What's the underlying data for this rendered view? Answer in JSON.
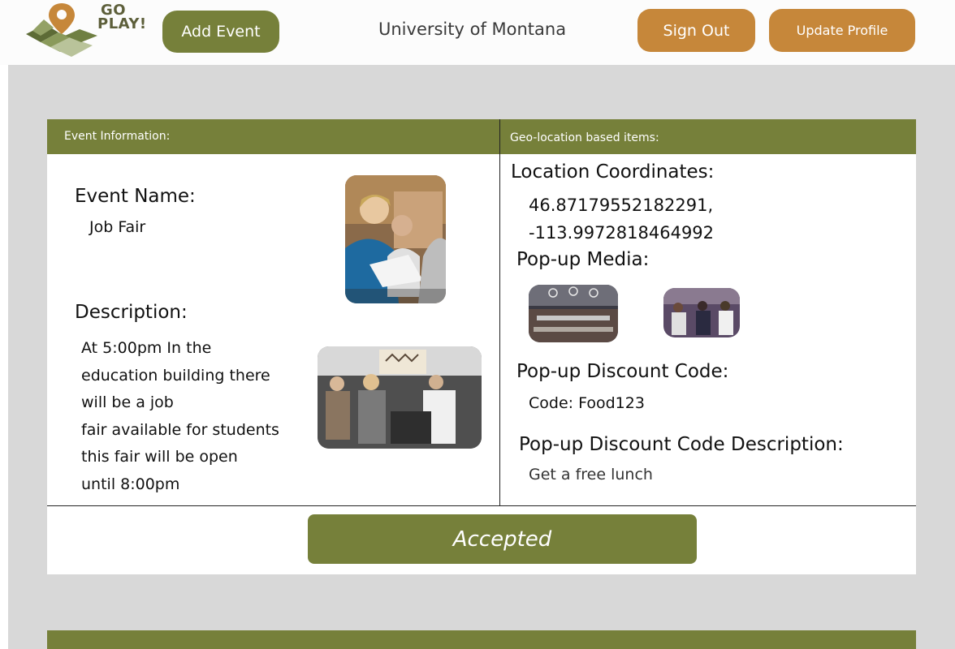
{
  "header": {
    "logo": {
      "line1": "GO",
      "line2": "PLAY!"
    },
    "add_event_label": "Add Event",
    "title": "University of Montana",
    "sign_out_label": "Sign Out",
    "update_profile_label": "Update Profile"
  },
  "event_card": {
    "event_info_header": "Event Information:",
    "geo_header": "Geo-location based items:",
    "event_name_label": "Event Name:",
    "event_name": "Job Fair",
    "description_label": "Description:",
    "description_lines": [
      "At 5:00pm In the",
      "education building there",
      "will be a job",
      "fair available for students",
      "this fair will be open",
      "until 8:00pm"
    ],
    "location_label": "Location Coordinates:",
    "latitude": "46.87179552182291,",
    "longitude": "-113.9972818464992",
    "media_label": "Pop-up Media:",
    "discount_code_label": "Pop-up Discount Code:",
    "discount_code": "Code: Food123",
    "discount_desc_label": "Pop-up Discount Code Description:",
    "discount_desc": "Get a free lunch",
    "status_label": "Accepted"
  },
  "colors": {
    "olive": "#76803a",
    "orange": "#c6873a",
    "gray_bg": "#d8d8d8"
  },
  "icons": [
    "map-pin-icon",
    "map-terrain-icon"
  ]
}
